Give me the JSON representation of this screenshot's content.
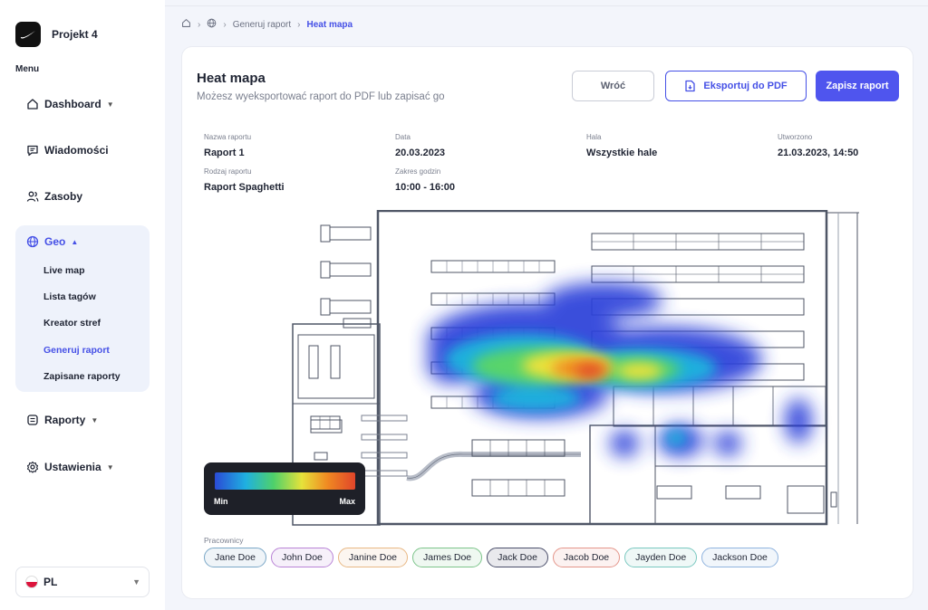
{
  "app": {
    "project_name": "Projekt 4",
    "menu_label": "Menu"
  },
  "nav": {
    "dashboard": "Dashboard",
    "messages": "Wiadomości",
    "resources": "Zasoby",
    "geo": "Geo",
    "geo_items": [
      "Live map",
      "Lista tagów",
      "Kreator stref",
      "Generuj raport",
      "Zapisane raporty"
    ],
    "active_geo_item": "Generuj raport",
    "reports": "Raporty",
    "settings": "Ustawienia"
  },
  "language": {
    "code": "PL"
  },
  "breadcrumb": {
    "items": [
      "Generuj raport",
      "Heat mapa"
    ]
  },
  "page": {
    "title": "Heat mapa",
    "subtitle": "Możesz wyeksportować raport do PDF lub zapisać go",
    "buttons": {
      "back": "Wróć",
      "export": "Eksportuj do PDF",
      "save": "Zapisz raport"
    }
  },
  "report": {
    "name_label": "Nazwa raportu",
    "name": "Raport 1",
    "type_label": "Rodzaj raportu",
    "type": "Raport Spaghetti",
    "date_label": "Data",
    "date": "20.03.2023",
    "hours_label": "Zakres godzin",
    "hours": "10:00 - 16:00",
    "hall_label": "Hala",
    "hall": "Wszystkie hale",
    "created_label": "Utworzono",
    "created": "21.03.2023, 14:50"
  },
  "legend": {
    "min": "Min",
    "max": "Max"
  },
  "workers": {
    "label": "Pracownicy",
    "list": [
      {
        "name": "Jane Doe",
        "color": "#7aa7c7"
      },
      {
        "name": "John Doe",
        "color": "#b983d6"
      },
      {
        "name": "Janine Doe",
        "color": "#e8b884"
      },
      {
        "name": "James Doe",
        "color": "#7cc48a"
      },
      {
        "name": "Jack Doe",
        "color": "#4a4e6a"
      },
      {
        "name": "Jacob Doe",
        "color": "#e4958a"
      },
      {
        "name": "Jayden Doe",
        "color": "#79c8c0"
      },
      {
        "name": "Jackson Doe",
        "color": "#8fb3de"
      }
    ]
  },
  "colors": {
    "accent": "#4f55ee",
    "sidebar_active_bg": "#eef2fb",
    "page_bg": "#f3f5fb"
  }
}
